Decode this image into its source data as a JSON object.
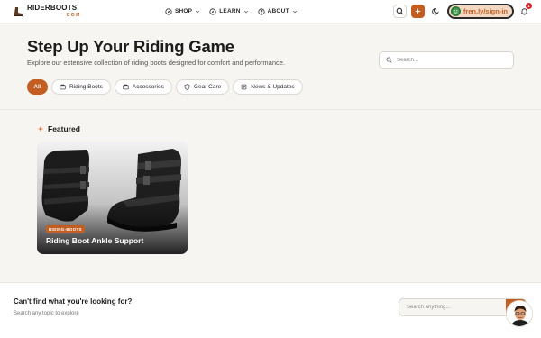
{
  "nav": {
    "logo_main": "RIDERBOOTS.",
    "logo_sub": "COM",
    "menu": [
      {
        "label": "SHOP",
        "icon": "compass-icon"
      },
      {
        "label": "LEARN",
        "icon": "compass-icon"
      },
      {
        "label": "ABOUT",
        "icon": "help-circle-icon"
      }
    ],
    "signin_label": "fren.ly/sign-in",
    "notification_count": "1"
  },
  "hero": {
    "title": "Step Up Your Riding Game",
    "subtitle": "Explore our extensive collection of riding boots designed for comfort and performance.",
    "search_placeholder": "Search...",
    "chips": [
      "All",
      "Riding Boots",
      "Accessories",
      "Gear Care",
      "News & Updates"
    ]
  },
  "featured": {
    "heading": "Featured",
    "card": {
      "tag": "RIDING-BOOTS",
      "title": "Riding Boot Ankle Support"
    }
  },
  "bottom": {
    "title": "Can't find what you're looking for?",
    "subtitle": "Search any topic to explore",
    "search_placeholder": "Search anything..."
  },
  "colors": {
    "accent": "#c25e21",
    "background": "#f7f5f2",
    "badge": "#d9262c"
  }
}
